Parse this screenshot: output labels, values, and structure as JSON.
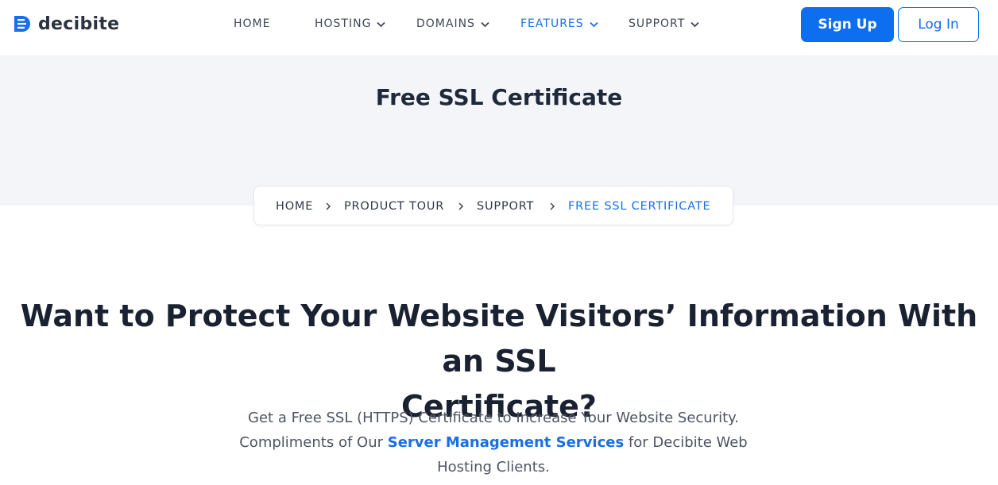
{
  "brand": {
    "name": "decibite",
    "color": "#1a6ee6"
  },
  "nav": {
    "items": [
      {
        "label": "HOME",
        "has_dropdown": false,
        "active": false
      },
      {
        "label": "HOSTING",
        "has_dropdown": true,
        "active": false
      },
      {
        "label": "DOMAINS",
        "has_dropdown": true,
        "active": false
      },
      {
        "label": "FEATURES",
        "has_dropdown": true,
        "active": true
      },
      {
        "label": "SUPPORT",
        "has_dropdown": true,
        "active": false
      }
    ],
    "signup_label": "Sign Up",
    "login_label": "Log In"
  },
  "hero": {
    "title": "Free SSL Certificate"
  },
  "breadcrumb": {
    "items": [
      "HOME",
      "PRODUCT TOUR",
      "SUPPORT",
      "FREE SSL CERTIFICATE"
    ],
    "separator_icon": "chevron-right-icon"
  },
  "main": {
    "headline_line1": "Want to Protect Your Website Visitors’ Information With an SSL",
    "headline_line2": "Certificate?",
    "lead_part1": "Get a Free SSL (HTTPS) Certificate to Increase Your Website Security. Compliments of Our ",
    "lead_link": "Server Management Services",
    "lead_part2": " for Decibite Web Hosting Clients."
  },
  "colors": {
    "accent": "#0d6ef0",
    "hero_background": "#f4f5f9",
    "text_dark": "#1e2a3b",
    "text_muted": "#4d5563"
  }
}
